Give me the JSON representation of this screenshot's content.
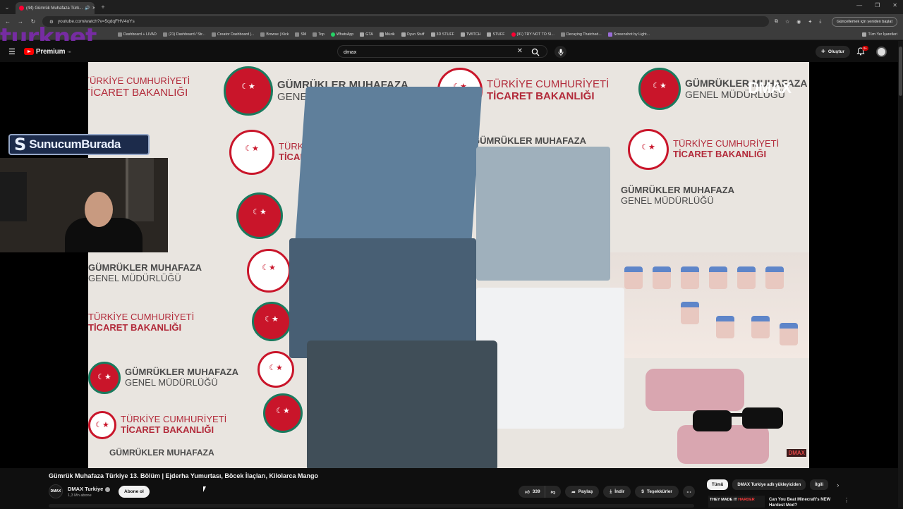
{
  "browser": {
    "tab_title": "(44) Gümrük Muhafaza Türk...",
    "url": "youtube.com/watch?v=5qdqFHV4oYs",
    "update_button": "Güncellemek için yeniden başlat",
    "bookmarks": [
      "Dashboard + LIVAD",
      "(21) Dashboard / Str...",
      "Creator Dashboard |...",
      "Browse | Kick",
      "SM",
      "Top",
      "WhatsApp",
      "GTA",
      "Müzik",
      "Oyun Stuff",
      "3D STUFF",
      "TWITCH",
      "STUFF",
      "(91) TRY NOT TO SI...",
      "Decaying Thatched...",
      "Screenshot by Light..."
    ],
    "bookmarks_right": "Tüm Yer İşaretleri"
  },
  "overlay": {
    "turknet": "turknet",
    "sunucum": "SunucumBurada",
    "sunucum_s": "S"
  },
  "youtube": {
    "logo_text": "Premium",
    "logo_tm": "TR",
    "search_value": "dmax",
    "create_label": "Oluştur",
    "notif_badge": "9+"
  },
  "video_frame": {
    "dmax_watermark": "DMAX",
    "dmax_small": "DMAX",
    "backdrop": [
      {
        "line1": "TÜRKİYE CUMHURİYETİ",
        "line2": "TİCARET BAKANLIĞI",
        "style": "red"
      },
      {
        "line1": "GÜMRÜKLER MUHAFAZA",
        "line2": "GENEL MÜDÜRLÜĞÜ",
        "style": "grey"
      }
    ]
  },
  "video": {
    "title": "Gümrük Muhafaza Türkiye 13. Bölüm | Ejderha Yumurtası, Böcek İlaçları, Kilolarca Mango",
    "channel": "DMAX Turkiye",
    "channel_avatar": "DMAX",
    "subscribers": "1,3 Mn abone",
    "subscribe_label": "Abone ol",
    "likes": "339",
    "share_label": "Paylaş",
    "download_label": "İndir",
    "thanks_label": "Teşekkürler"
  },
  "sidebar": {
    "chips": [
      "Tümü",
      "DMAX Turkiye adlı yükleyiciden",
      "İlgili"
    ],
    "rec_thumb_text": "THEY MADE IT",
    "rec_thumb_accent": "HARDER",
    "rec_title": "Can You Beat Minecraft's NEW Hardest Mod?"
  }
}
